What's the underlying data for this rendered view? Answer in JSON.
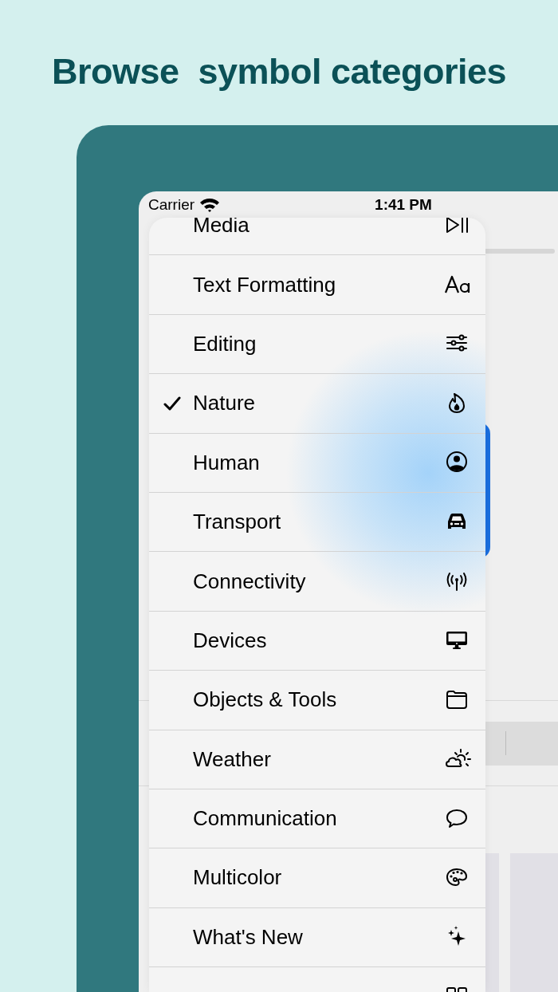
{
  "headline": "Browse  symbol categories",
  "status_bar": {
    "carrier": "Carrier",
    "time": "1:41 PM"
  },
  "menu": {
    "items": [
      {
        "label": "Media",
        "selected": false
      },
      {
        "label": "Text Formatting",
        "selected": false
      },
      {
        "label": "Editing",
        "selected": false
      },
      {
        "label": "Nature",
        "selected": true
      },
      {
        "label": "Human",
        "selected": false
      },
      {
        "label": "Transport",
        "selected": false
      },
      {
        "label": "Connectivity",
        "selected": false
      },
      {
        "label": "Devices",
        "selected": false
      },
      {
        "label": "Objects & Tools",
        "selected": false
      },
      {
        "label": "Weather",
        "selected": false
      },
      {
        "label": "Communication",
        "selected": false
      },
      {
        "label": "Multicolor",
        "selected": false
      },
      {
        "label": "What's New",
        "selected": false
      },
      {
        "selected": false
      }
    ]
  }
}
